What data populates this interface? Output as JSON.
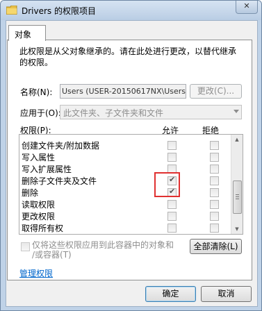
{
  "window": {
    "title": "Drivers 的权限项目",
    "close_label": "✕"
  },
  "tabs": [
    {
      "label": "对象"
    }
  ],
  "description": "此权限是从父对象继承的。请在此处进行更改，以替代继承的权限。",
  "name_field": {
    "label": "名称(N):",
    "value": "Users (USER-20150617NX\\Users)"
  },
  "change_button": {
    "label": "更改(C)..."
  },
  "apply_to": {
    "label": "应用于(O):",
    "value": "此文件夹、子文件夹和文件"
  },
  "permissions": {
    "label": "权限(P):",
    "allow_header": "允许",
    "deny_header": "拒绝",
    "rows": [
      {
        "label": "创建文件夹/附加数据",
        "allow": false,
        "deny": false
      },
      {
        "label": "写入属性",
        "allow": false,
        "deny": false
      },
      {
        "label": "写入扩展属性",
        "allow": false,
        "deny": false
      },
      {
        "label": "删除子文件夹及文件",
        "allow": true,
        "deny": false
      },
      {
        "label": "删除",
        "allow": true,
        "deny": false
      },
      {
        "label": "读取权限",
        "allow": false,
        "deny": false
      },
      {
        "label": "更改权限",
        "allow": false,
        "deny": false
      },
      {
        "label": "取得所有权",
        "allow": false,
        "deny": false
      }
    ]
  },
  "apply_only_checkbox": {
    "line1": "仅将这些权限应用到此容器中的对象和",
    "line2": "/或容器(T)",
    "checked": false
  },
  "clear_all_button": {
    "label": "全部清除(L)"
  },
  "manage_link": {
    "label": "管理权限"
  },
  "ok_button": {
    "label": "确定"
  },
  "cancel_button": {
    "label": "取消"
  },
  "colors": {
    "highlight": "#e03030",
    "link": "#0066cc"
  }
}
